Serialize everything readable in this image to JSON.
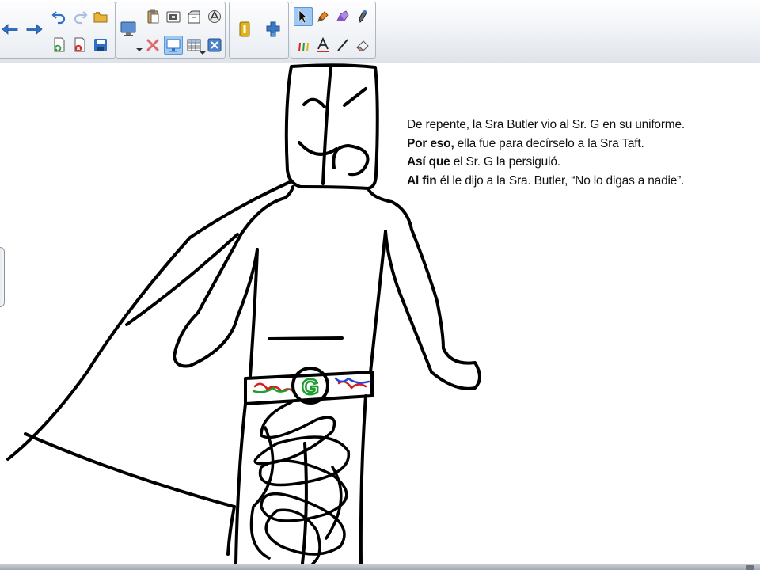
{
  "toolbar": {
    "buttons": [
      "back-icon",
      "forward-icon",
      "undo-icon",
      "redo-icon",
      "open-file-icon",
      "new-page-icon",
      "delete-page-icon",
      "save-icon",
      "screen-display-icon",
      "paste-icon",
      "screen-capture-icon",
      "screen-shade-icon",
      "document-camera-icon",
      "delete-icon",
      "full-screen-icon",
      "table-icon",
      "close-icon",
      "capture-icon",
      "add-ons-icon",
      "select-icon",
      "pen-icon",
      "highlighter-icon",
      "magic-pen-icon",
      "creative-pen-icon",
      "text-icon",
      "line-icon",
      "eraser-icon"
    ],
    "active": [
      "full-screen-icon",
      "select-icon"
    ],
    "colors": {
      "blue": "#2f6fc4",
      "orange": "#e8861b",
      "red": "#d12a2a",
      "green": "#2d9b3a",
      "purple": "#8a52c8",
      "gold": "#e0b319"
    }
  },
  "story": {
    "line1": {
      "text": "De repente, la Sra Butler vio al Sr. G en su uniforme."
    },
    "line2": {
      "bold": "Por eso,",
      "text": " ella fue para decírselo a la Sra Taft."
    },
    "line3": {
      "bold": "Así que",
      "text": " el Sr. G la persiguió."
    },
    "line4": {
      "bold": "Al fin",
      "text": " él le dijo a la Sra. Butler, “No lo digas a nadie”."
    }
  },
  "drawing": {
    "belt_letter": "G",
    "ink_color": "#000000",
    "scribble_colors": [
      "#d42020",
      "#1e9e2f",
      "#2247d4"
    ]
  }
}
